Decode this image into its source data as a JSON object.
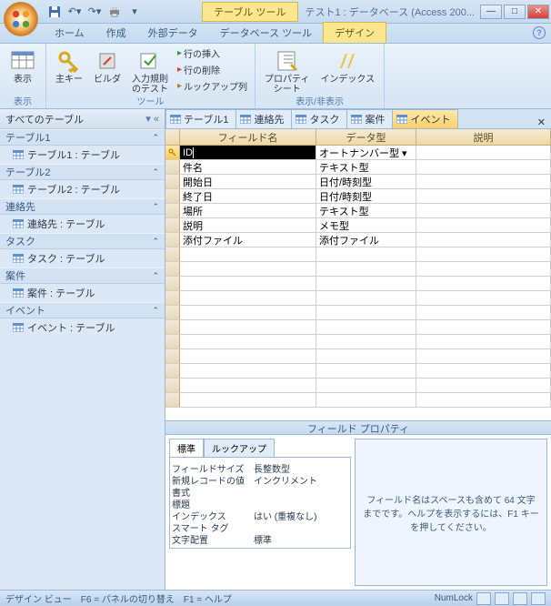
{
  "titlebar": {
    "context_tab": "テーブル ツール",
    "title": "テスト1 : データベース (Access 200..."
  },
  "tabs": [
    "ホーム",
    "作成",
    "外部データ",
    "データベース ツール",
    "デザイン"
  ],
  "active_tab": 4,
  "ribbon": {
    "groups": {
      "view": {
        "label": "表示",
        "items": {
          "view": "表示"
        }
      },
      "tools": {
        "label": "ツール",
        "items": {
          "pk": "主キー",
          "builder": "ビルダ",
          "rules": "入力規則\nのテスト",
          "insert_row": "行の挿入",
          "delete_row": "行の削除",
          "lookup": "ルックアップ列"
        }
      },
      "showhide": {
        "label": "表示/非表示",
        "items": {
          "prop": "プロパティ\nシート",
          "index": "インデックス"
        }
      }
    }
  },
  "nav": {
    "header": "すべてのテーブル",
    "groups": [
      {
        "name": "テーブル1",
        "items": [
          "テーブル1 : テーブル"
        ]
      },
      {
        "name": "テーブル2",
        "items": [
          "テーブル2 : テーブル"
        ]
      },
      {
        "name": "連絡先",
        "items": [
          "連絡先 : テーブル"
        ]
      },
      {
        "name": "タスク",
        "items": [
          "タスク : テーブル"
        ]
      },
      {
        "name": "案件",
        "items": [
          "案件 : テーブル"
        ]
      },
      {
        "name": "イベント",
        "items": [
          "イベント : テーブル"
        ]
      }
    ]
  },
  "doc_tabs": [
    "テーブル1",
    "連絡先",
    "タスク",
    "案件",
    "イベント"
  ],
  "active_doc_tab": 4,
  "grid": {
    "headers": {
      "name": "フィールド名",
      "type": "データ型",
      "desc": "説明"
    },
    "rows": [
      {
        "name": "ID",
        "type": "オートナンバー型",
        "pk": true
      },
      {
        "name": "件名",
        "type": "テキスト型"
      },
      {
        "name": "開始日",
        "type": "日付/時刻型"
      },
      {
        "name": "終了日",
        "type": "日付/時刻型"
      },
      {
        "name": "場所",
        "type": "テキスト型"
      },
      {
        "name": "説明",
        "type": "メモ型"
      },
      {
        "name": "添付ファイル",
        "type": "添付ファイル"
      }
    ]
  },
  "prop": {
    "title": "フィールド プロパティ",
    "tabs": [
      "標準",
      "ルックアップ"
    ],
    "rows": [
      {
        "label": "フィールドサイズ",
        "value": "長整数型"
      },
      {
        "label": "新規レコードの値",
        "value": "インクリメント"
      },
      {
        "label": "書式",
        "value": ""
      },
      {
        "label": "標題",
        "value": ""
      },
      {
        "label": "インデックス",
        "value": "はい (重複なし)"
      },
      {
        "label": "スマート タグ",
        "value": ""
      },
      {
        "label": "文字配置",
        "value": "標準"
      }
    ],
    "help": "フィールド名はスペースも含めて 64 文字までです。ヘルプを表示するには、F1 キーを押してください。"
  },
  "status": {
    "left": "デザイン ビュー　F6 = パネルの切り替え　F1 = ヘルプ",
    "numlock": "NumLock"
  }
}
